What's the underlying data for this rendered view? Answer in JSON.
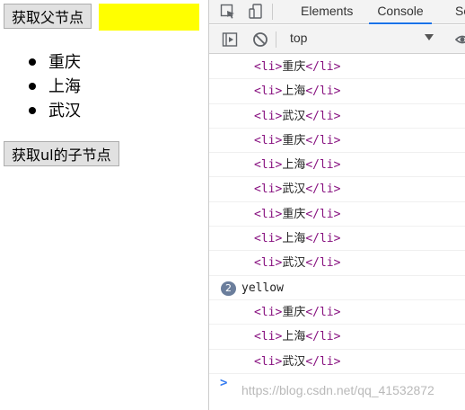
{
  "page": {
    "get_parent_button": "获取父节点",
    "parent_box_color": "#ffff00",
    "cities": [
      "重庆",
      "上海",
      "武汉"
    ],
    "get_children_button": "获取ul的子节点"
  },
  "devtools": {
    "tabs": {
      "elements": "Elements",
      "console": "Console",
      "sources": "So"
    },
    "toolbar": {
      "context": "top"
    },
    "console_rows": [
      {
        "kind": "element",
        "text": "重庆"
      },
      {
        "kind": "element",
        "text": "上海"
      },
      {
        "kind": "element",
        "text": "武汉"
      },
      {
        "kind": "element",
        "text": "重庆"
      },
      {
        "kind": "element",
        "text": "上海"
      },
      {
        "kind": "element",
        "text": "武汉"
      },
      {
        "kind": "element",
        "text": "重庆"
      },
      {
        "kind": "element",
        "text": "上海"
      },
      {
        "kind": "element",
        "text": "武汉"
      },
      {
        "kind": "log",
        "count": "2",
        "text": "yellow"
      },
      {
        "kind": "element",
        "text": "重庆"
      },
      {
        "kind": "element",
        "text": "上海"
      },
      {
        "kind": "element",
        "text": "武汉"
      }
    ],
    "tag_open": "<li>",
    "tag_close": "</li>",
    "prompt": ">",
    "watermark": "https://blog.csdn.net/qq_41532872"
  }
}
